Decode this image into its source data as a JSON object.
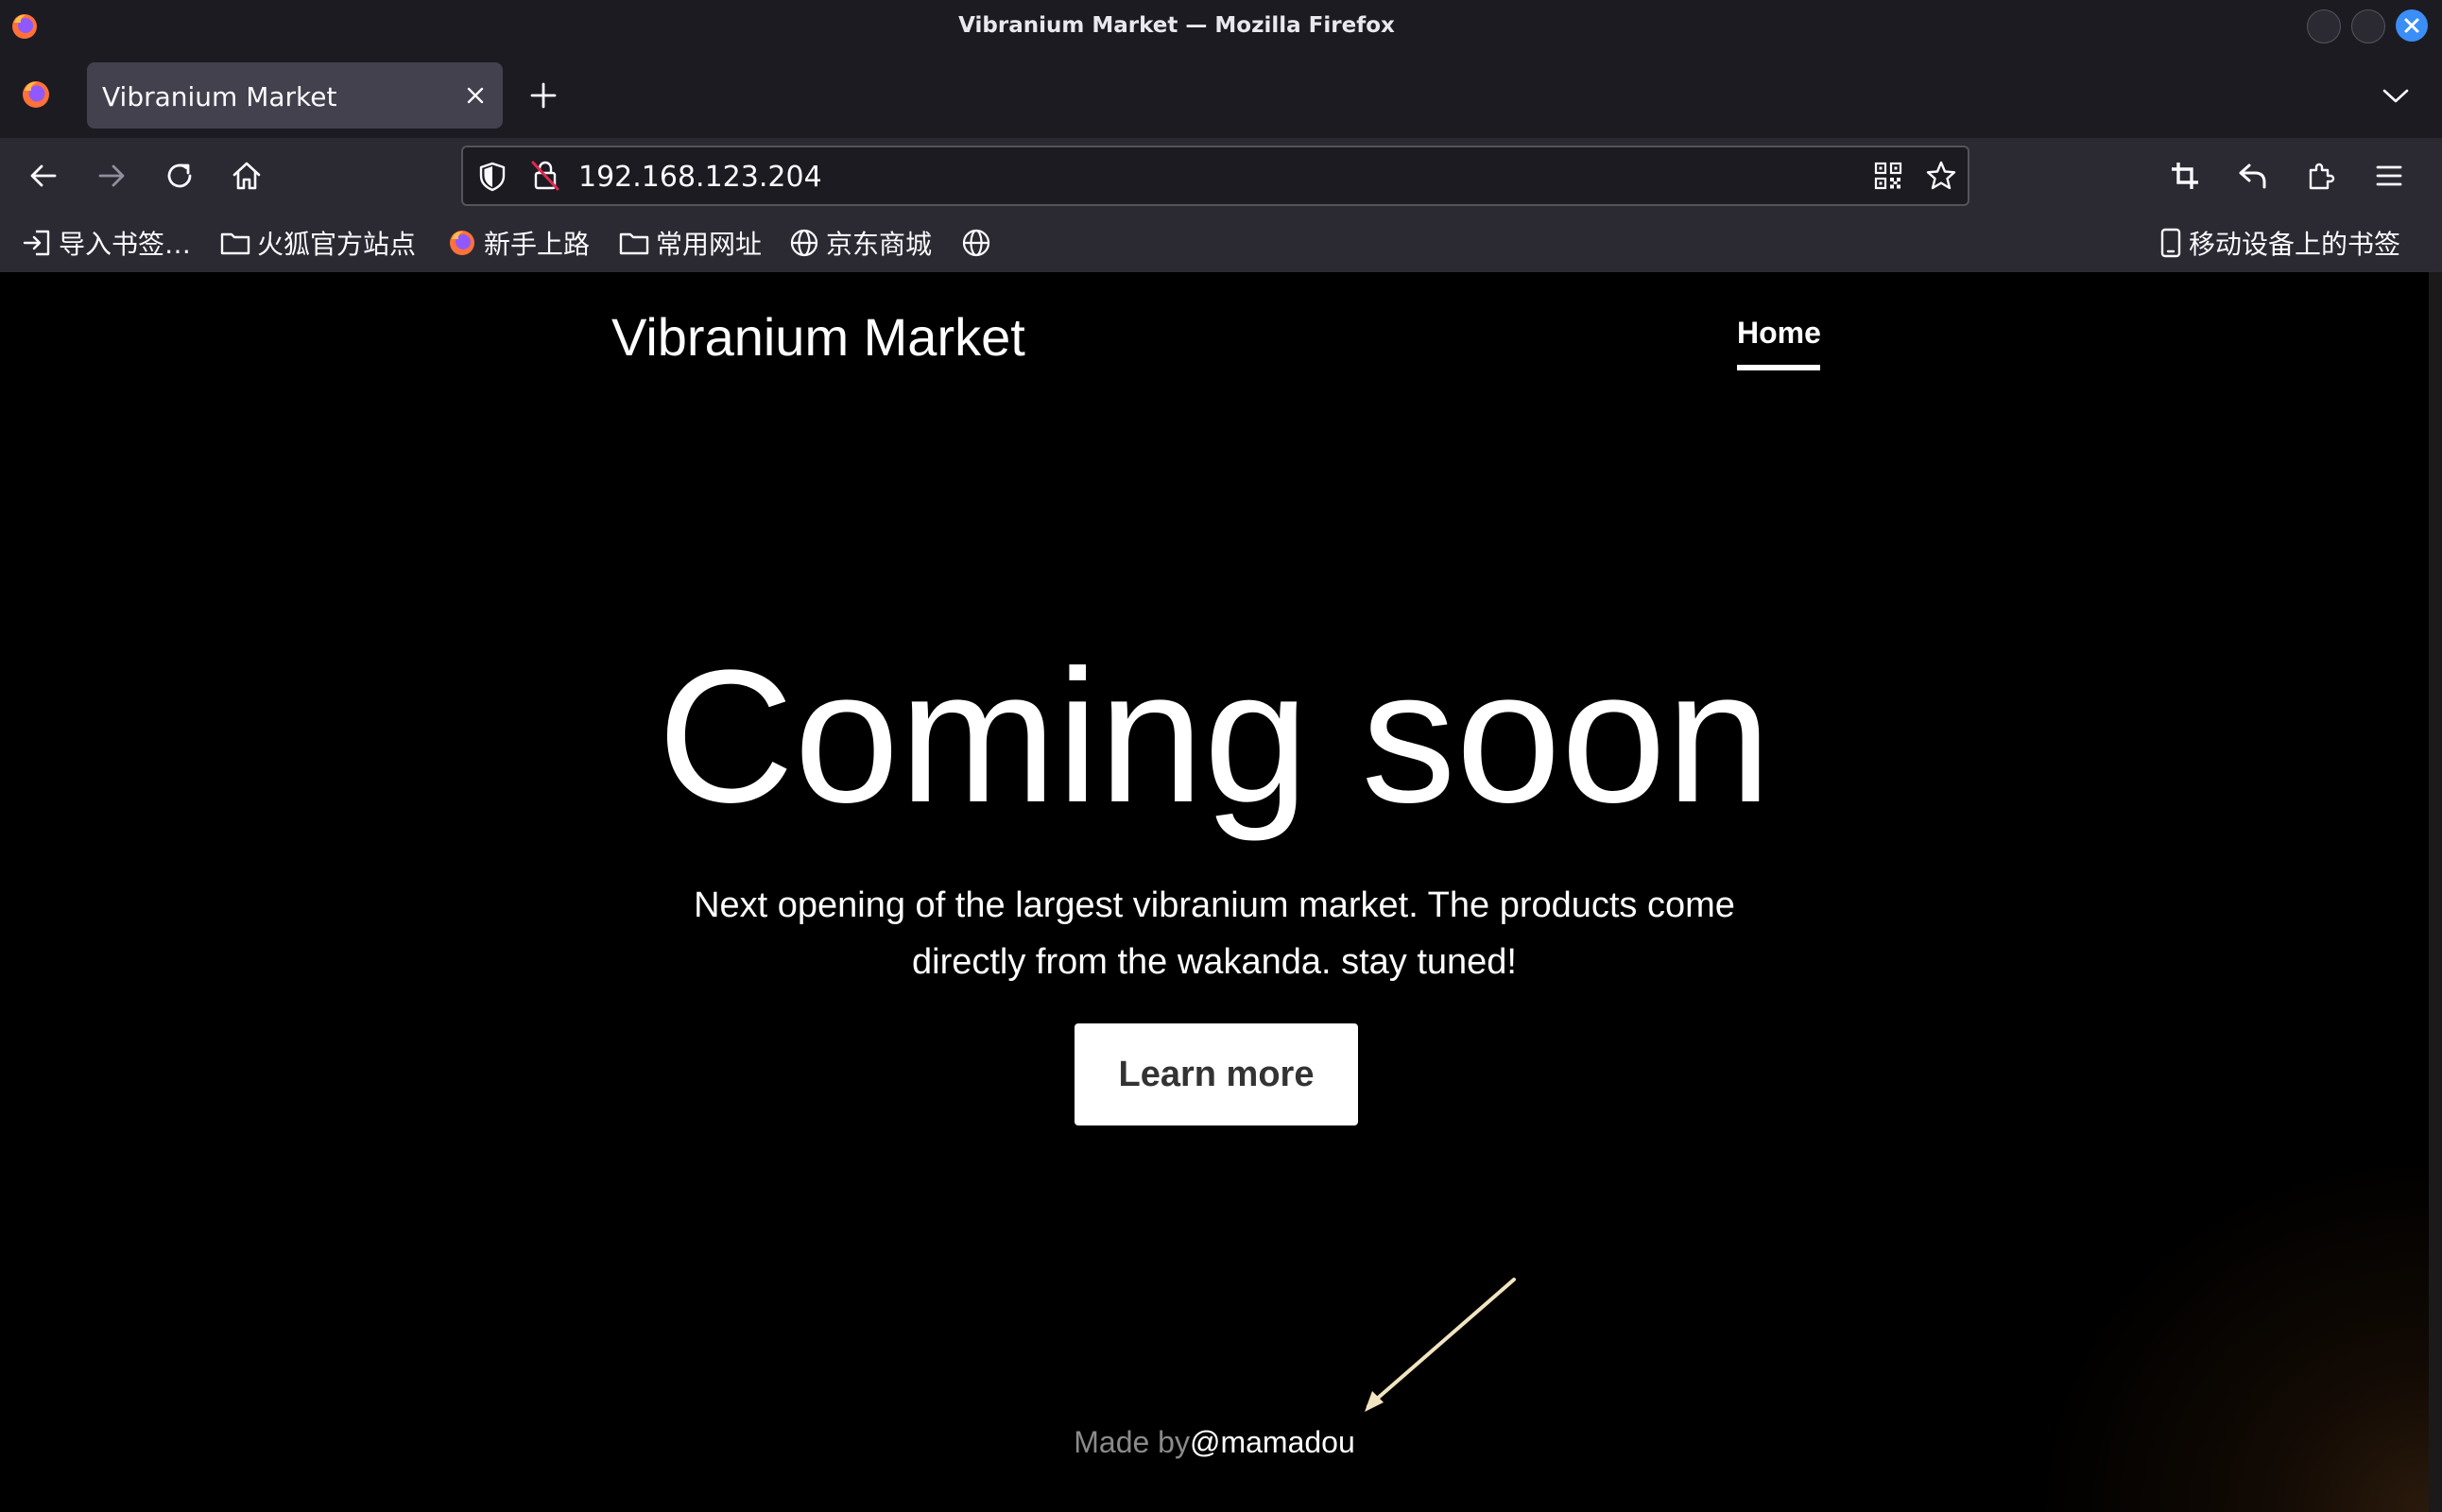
{
  "window": {
    "title": "Vibranium Market — Mozilla Firefox"
  },
  "tab": {
    "title": "Vibranium Market"
  },
  "urlbar": {
    "url": "192.168.123.204"
  },
  "bookmarks": {
    "items": [
      {
        "label": "导入书签…",
        "icon": "import-icon"
      },
      {
        "label": "火狐官方站点",
        "icon": "folder-icon"
      },
      {
        "label": "新手上路",
        "icon": "firefox-icon"
      },
      {
        "label": "常用网址",
        "icon": "folder-icon"
      },
      {
        "label": "京东商城",
        "icon": "globe-icon"
      },
      {
        "label": "",
        "icon": "globe-icon"
      }
    ],
    "mobile": "移动设备上的书签"
  },
  "site": {
    "brand": "Vibranium Market",
    "nav_home": "Home",
    "hero_title": "Coming soon",
    "hero_line1": "Next opening of the largest vibranium market. The products come",
    "hero_line2": "directly from the wakanda. stay tuned!",
    "cta": "Learn more",
    "footer_made": "Made by",
    "footer_author": "@mamadou"
  },
  "colors": {
    "accent_close": "#3a8ef6",
    "arrow": "#f1e4c0"
  }
}
